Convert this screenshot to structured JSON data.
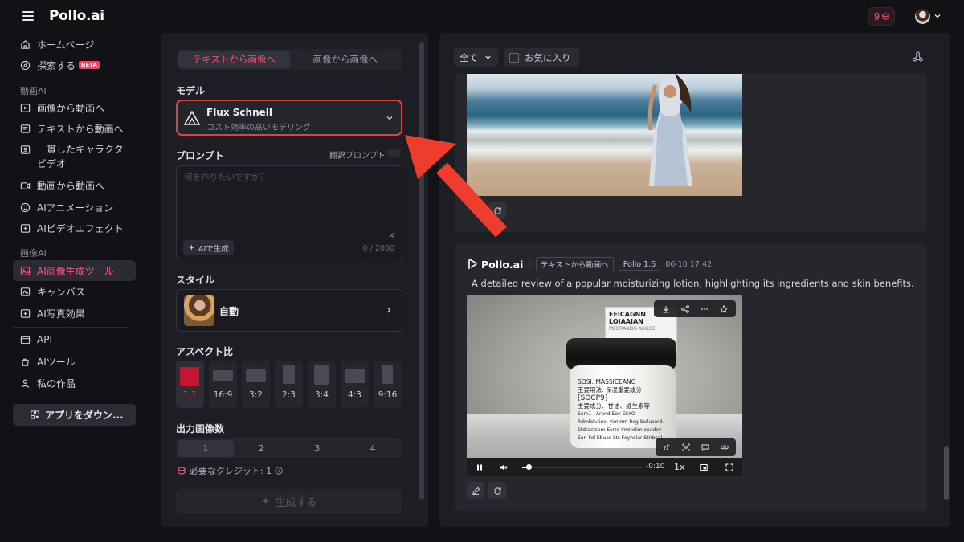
{
  "header": {
    "logo": "Pollo.ai",
    "credits": "9"
  },
  "sidebar": {
    "top_items": [
      {
        "label": "ホームページ",
        "icon": "home-icon"
      },
      {
        "label": "探索する",
        "icon": "compass-icon",
        "badge": "BETA"
      }
    ],
    "video_section_label": "動画AI",
    "video_items": [
      {
        "label": "画像から動画へ",
        "icon": "image-video-icon"
      },
      {
        "label": "テキストから動画へ",
        "icon": "text-video-icon"
      },
      {
        "label": "一貫したキャラクター",
        "label2": "ビデオ",
        "icon": "character-icon"
      },
      {
        "label": "動画から動画へ",
        "icon": "video-video-icon"
      },
      {
        "label": "AIアニメーション",
        "icon": "animation-icon"
      },
      {
        "label": "AIビデオエフェクト",
        "icon": "effect-icon"
      }
    ],
    "image_section_label": "画像AI",
    "image_items": [
      {
        "label": "AI画像生成ツール",
        "icon": "image-gen-icon",
        "active": true
      },
      {
        "label": "キャンバス",
        "icon": "canvas-icon"
      },
      {
        "label": "AI写真効果",
        "icon": "photo-effect-icon"
      }
    ],
    "bottom_items": [
      {
        "label": "API",
        "icon": "api-icon"
      },
      {
        "label": "AIツール",
        "icon": "tools-icon"
      },
      {
        "label": "私の作品",
        "icon": "works-icon"
      }
    ],
    "download_label": "アプリをダウン..."
  },
  "form": {
    "tabs": [
      "テキストから画像へ",
      "画像から画像へ"
    ],
    "active_tab": 0,
    "model_label": "モデル",
    "model_name": "Flux Schnell",
    "model_desc": "コスト効率の高いモデリング",
    "prompt_label": "プロンプト",
    "translate_label": "翻訳プロンプト",
    "prompt_value": "",
    "prompt_placeholder": "何を作りたいですか？",
    "ai_generate_label": "AIで生成",
    "char_count": "0 / 2000",
    "style_label": "スタイル",
    "style_value": "自動",
    "aspect_label": "アスペクト比",
    "aspect_options": [
      "1:1",
      "16:9",
      "3:2",
      "2:3",
      "3:4",
      "4:3",
      "9:16"
    ],
    "aspect_active": "1:1",
    "count_label": "出力画像数",
    "count_options": [
      "1",
      "2",
      "3",
      "4"
    ],
    "count_active": "1",
    "credits_required": "必要なクレジット: 1",
    "generate_label": "生成する"
  },
  "gallery": {
    "filter_value": "全て",
    "favorites_label": "お気に入り",
    "card": {
      "brand": "Pollo.ai",
      "mode_chip": "テキストから動画へ",
      "model_chip": "Pollo 1.6",
      "timestamp": "06-10 17:42",
      "caption": "A detailed review of a popular moisturizing lotion, highlighting its ingredients and skin benefits.",
      "time_remaining": "-0:10",
      "speed": "1x",
      "progress": 0.05,
      "tag_text": [
        "EEICAGNN",
        "LOIAAIAN",
        "MEBRANDG ASGOE"
      ],
      "jar_text": [
        "SOSI: MASSICEANO",
        "王要用法: 保湿重要成分",
        "[SOCP9]",
        "主要成分、甘油、维生素等",
        "Sem1 . Arand Eay ESXO",
        "Rdmlehaine, yimmm Reg Seiluserd.",
        "Stdtactsem Eerte Imetelimieoadey",
        "Eorl Fel Ebuas Lts Foyhelar Stnbeal"
      ]
    }
  },
  "colors": {
    "accent": "#ff4d6a",
    "highlight": "#e8402f",
    "panel": "#1d1d24",
    "background": "#111116"
  }
}
